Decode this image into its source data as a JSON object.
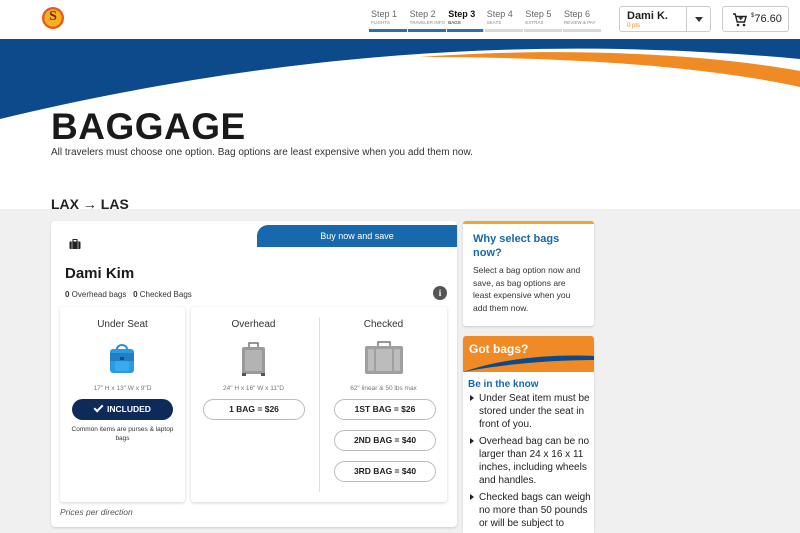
{
  "header": {
    "logo_letter": "S",
    "steps": [
      {
        "title": "Step 1",
        "sub": "FLIGHTS",
        "active": false
      },
      {
        "title": "Step 2",
        "sub": "TRAVELER INFO",
        "active": false
      },
      {
        "title": "Step 3",
        "sub": "BAGS",
        "active": true
      },
      {
        "title": "Step 4",
        "sub": "SEATS",
        "active": false
      },
      {
        "title": "Step 5",
        "sub": "EXTRAS",
        "active": false
      },
      {
        "title": "Step 6",
        "sub": "REVIEW & PAY",
        "active": false
      }
    ],
    "progress_fraction": 0.49,
    "user_name": "Dami K.",
    "user_points": "0 pts",
    "cart_currency": "$",
    "cart_amount": "76.60"
  },
  "page": {
    "title": "BAGGAGE",
    "subtitle": "All travelers must choose one option. Bag options are least expensive when you add them now.",
    "route_from": "LAX",
    "route_arrow": "→",
    "route_to": "LAS"
  },
  "traveler_card": {
    "banner": "Buy now and save",
    "name": "Dami Kim",
    "overhead_count": "0",
    "overhead_label": " Overhead bags",
    "checked_count": "0",
    "checked_label": " Checked Bags",
    "info_icon": "i",
    "under_seat": {
      "title": "Under Seat",
      "dimensions": "17\" H x 13\" W x 9\"D",
      "button": "INCLUDED",
      "note": "Common items are purses & laptop bags"
    },
    "overhead": {
      "title": "Overhead",
      "dimensions": "24\" H x 16\" W x 11\"D",
      "button": "1 BAG = $26"
    },
    "checked": {
      "title": "Checked",
      "dimensions": "62\" linear & 50 lbs max",
      "buttons": [
        "1ST BAG = $26",
        "2ND BAG = $40",
        "3RD BAG = $40"
      ]
    },
    "prices_note": "Prices per direction"
  },
  "sidebar": {
    "why_title": "Why select bags now?",
    "why_body": "Select a bag option now and save, as bag options are least expensive when you add them now.",
    "got_title": "Got bags?",
    "know_title": "Be in the know",
    "tips": [
      "Under Seat item must be stored under the seat in front of you.",
      "Overhead bag can be no larger than 24 x 16 x 11 inches, including wheels and handles.",
      "Checked bags can weigh no more than 50 pounds or will be subject to"
    ]
  },
  "colors": {
    "brand_blue": "#1768ac",
    "navy": "#0d2a5b",
    "orange": "#f08a24"
  }
}
